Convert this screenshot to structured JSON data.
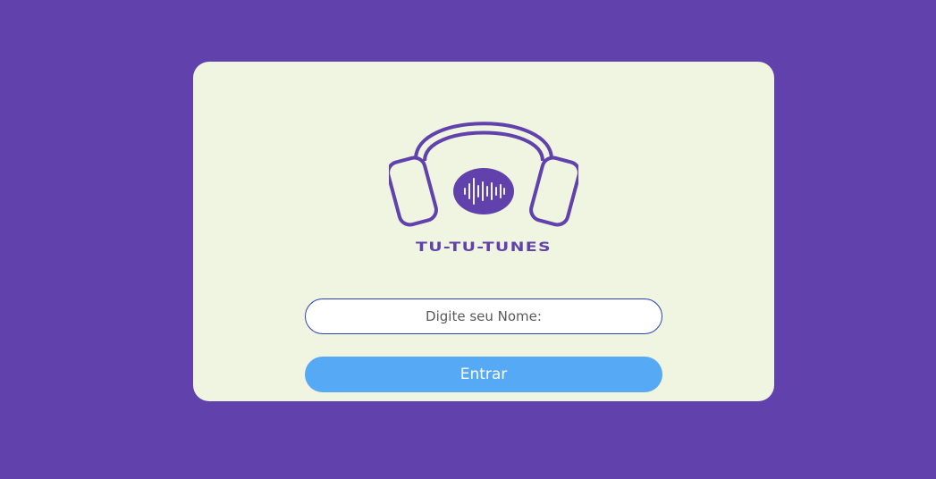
{
  "app": {
    "brand_name": "TU-TU-TUNES",
    "logo_icon": "headphones-soundwave-icon"
  },
  "login": {
    "name_placeholder": "Digite seu Nome:",
    "name_value": "",
    "enter_label": "Entrar"
  },
  "colors": {
    "background": "#6141ab",
    "card": "#eff5e1",
    "accent": "#6141ab",
    "button": "#56a9f4",
    "input_border": "#2a3fb8"
  }
}
